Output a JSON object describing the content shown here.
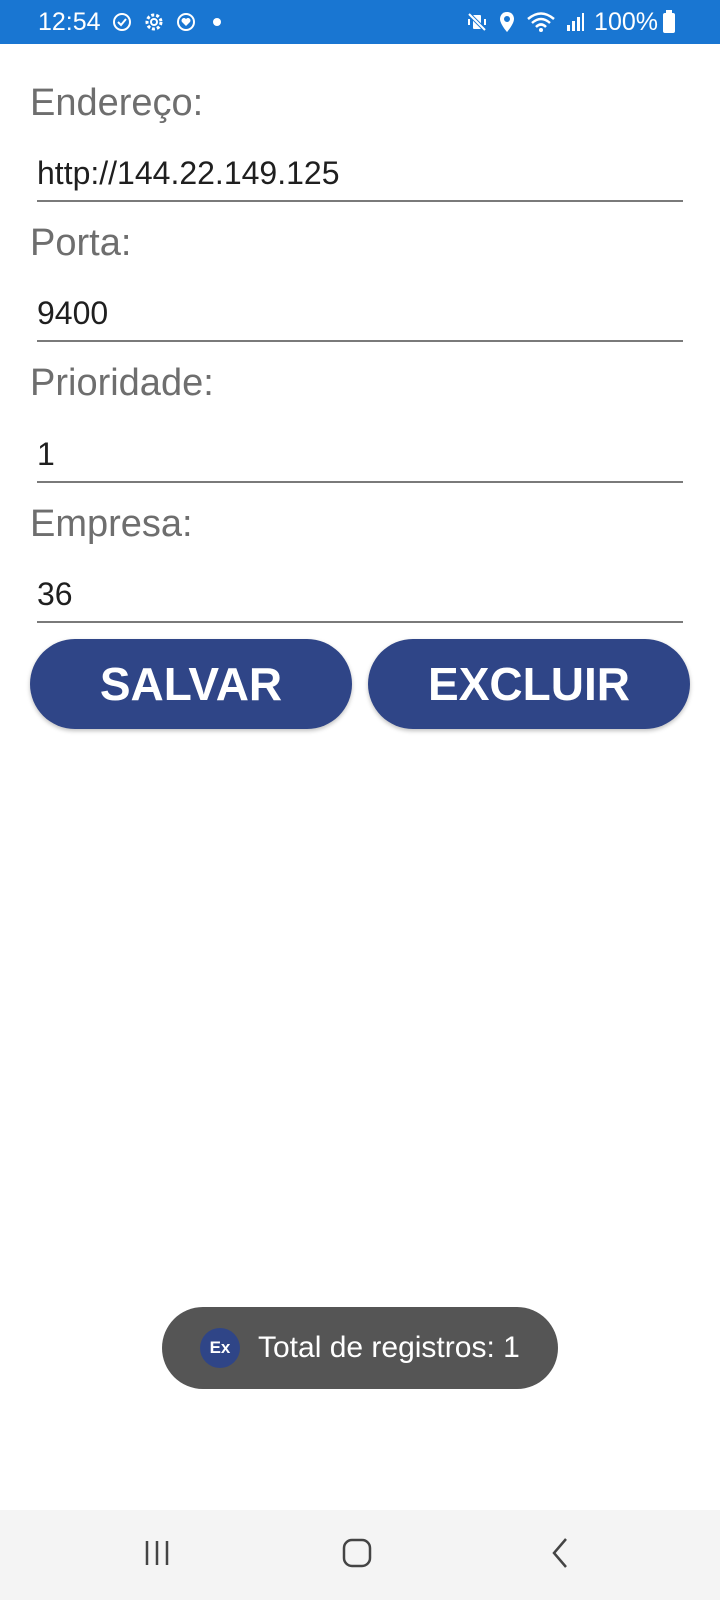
{
  "status_bar": {
    "time": "12:54",
    "battery_percent": "100%",
    "icons_left": [
      "sync-icon",
      "settings-icon",
      "health-icon",
      "notification-dot"
    ],
    "icons_right": [
      "mute-vibrate-icon",
      "location-icon",
      "wifi-icon",
      "signal-icon",
      "battery-icon"
    ]
  },
  "form": {
    "fields": [
      {
        "label": "Endereço:",
        "value": "http://144.22.149.125"
      },
      {
        "label": "Porta:",
        "value": "9400"
      },
      {
        "label": "Prioridade:",
        "value": "1"
      },
      {
        "label": "Empresa:",
        "value": "36"
      }
    ]
  },
  "buttons": {
    "save_label": "SALVAR",
    "delete_label": "EXCLUIR"
  },
  "toast": {
    "icon_text": "Ex",
    "message": "Total de registros: 1"
  },
  "nav_bar": {
    "buttons": [
      "recents-icon",
      "home-icon",
      "back-icon"
    ]
  },
  "colors": {
    "status_bar": "#1976D2",
    "button": "#2F4587",
    "toast_bg": "#555555",
    "label_gray": "#6e6e6e"
  }
}
